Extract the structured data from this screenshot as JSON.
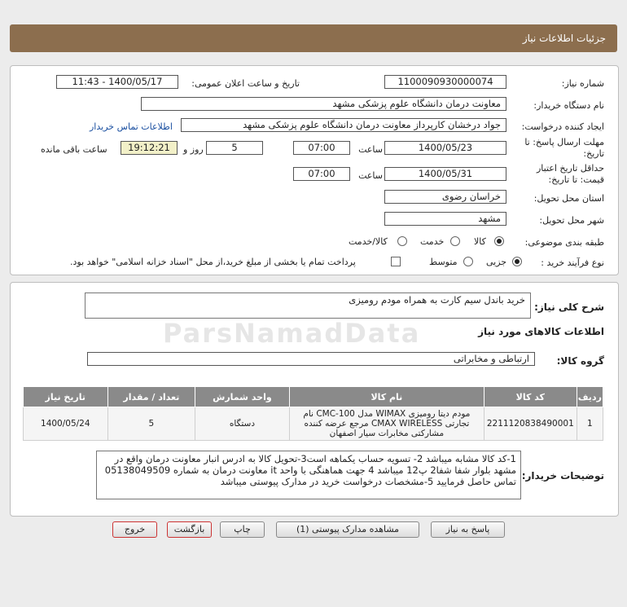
{
  "header": {
    "title": "جزئیات اطلاعات نیاز"
  },
  "form": {
    "need_number_label": "شماره نیاز:",
    "need_number": "1100090930000074",
    "announce_label": "تاریخ و ساعت اعلان عمومی:",
    "announce_value": "1400/05/17 - 11:43",
    "buyer_org_label": "نام دستگاه خریدار:",
    "buyer_org": "معاونت درمان دانشگاه علوم پزشکی مشهد",
    "creator_label": "ایجاد کننده درخواست:",
    "creator": "جواد درخشان کارپرداز معاونت درمان دانشگاه علوم پزشکی مشهد",
    "contact_link": "اطلاعات تماس خریدار",
    "deadline_label": "مهلت ارسال پاسخ: تا تاریخ:",
    "deadline_date": "1400/05/23",
    "time_label": "ساعت",
    "deadline_time": "07:00",
    "days_value": "5",
    "days_label": "روز و",
    "remaining_time": "19:12:21",
    "remaining_label": "ساعت باقی مانده",
    "validity_label": "حداقل تاریخ اعتبار قیمت: تا تاریخ:",
    "validity_date": "1400/05/31",
    "validity_time": "07:00",
    "province_label": "استان محل تحویل:",
    "province": "خراسان رضوی",
    "city_label": "شهر محل تحویل:",
    "city": "مشهد",
    "category_label": "طبقه بندی موضوعی:",
    "category_options": [
      "کالا",
      "خدمت",
      "کالا/خدمت"
    ],
    "process_label": "نوع فرآیند خرید :",
    "process_options": [
      "جزیی",
      "متوسط"
    ],
    "payment_note": "پرداخت تمام یا بخشی از مبلغ خرید،از محل \"اسناد خزانه اسلامی\" خواهد بود."
  },
  "details": {
    "summary_label": "شرح کلی نیاز:",
    "summary": "خرید باندل سیم کارت به همراه مودم رومیزی",
    "goods_info_title": "اطلاعات کالاهای مورد نیاز",
    "group_label": "گروه کالا:",
    "group_value": "ارتباطی و مخابراتی",
    "table": {
      "headers": [
        "ردیف",
        "کد کالا",
        "نام کالا",
        "واحد شمارش",
        "تعداد / مقدار",
        "تاریخ نیاز"
      ],
      "rows": [
        [
          "1",
          "2211120838490001",
          "مودم دیتا رومیزی WIMAX مدل CMC-100 نام تجارتی CMAX WIRELESS مرجع عرضه کننده مشارکتی مخابرات سیار اصفهان",
          "دستگاه",
          "5",
          "1400/05/24"
        ]
      ]
    },
    "buyer_notes_label": "توضیحات خریدار:",
    "buyer_notes": "1-کد کالا مشابه میباشد 2- تسویه حساب یکماهه است3-تحویل کالا به ادرس انبار معاونت درمان واقع در مشهد بلوار شفا شفا2 پ12 میباشد 4 جهت هماهنگی با واحد it معاونت درمان به شماره 05138049509 تماس حاصل فرمایید 5-مشخصات درخواست خرید در مدارک پیوستی میباشد"
  },
  "buttons": {
    "reply": "پاسخ به نیاز",
    "view_docs": "مشاهده مدارک پیوستی (1)",
    "print": "چاپ",
    "back": "بازگشت",
    "exit": "خروج"
  },
  "watermark": "ParsNamadData"
}
